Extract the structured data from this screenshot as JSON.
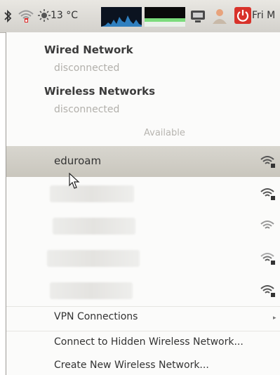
{
  "panel": {
    "temperature": "13 °C",
    "clock": "Fri M",
    "icons": [
      "bluetooth-icon",
      "network-icon",
      "weather-icon",
      "system-monitor-icon",
      "battery-icon",
      "display-icon",
      "user-icon",
      "power-icon"
    ]
  },
  "menu": {
    "wired_header": "Wired Network",
    "wired_status": "disconnected",
    "wireless_header": "Wireless Networks",
    "wireless_status": "disconnected",
    "available_label": "Available",
    "networks": [
      {
        "name": "eduroam",
        "highlighted": true
      },
      {
        "name": "",
        "highlighted": false
      },
      {
        "name": "",
        "highlighted": false
      },
      {
        "name": "",
        "highlighted": false
      },
      {
        "name": "",
        "highlighted": false
      }
    ],
    "vpn_label": "VPN Connections",
    "hidden_network_label": "Connect to Hidden Wireless Network...",
    "create_network_label": "Create New Wireless Network..."
  }
}
